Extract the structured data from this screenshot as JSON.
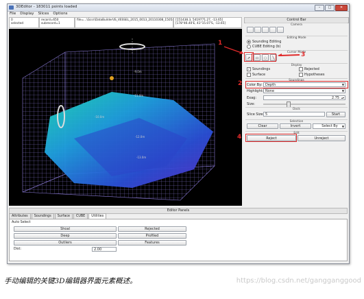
{
  "window": {
    "title": "3DEditor - 183011 points loaded",
    "controls": {
      "minimize": "–",
      "maximize": "□",
      "close": "✕"
    }
  },
  "menu": [
    "File",
    "Display",
    "Slices",
    "Options"
  ],
  "info": {
    "selection": "0\nselected",
    "record": "record=650\nsubrecord=1",
    "file": "file=...\\Gcsr\\DataBuilder\\IS_VESSEL_2015_0013_20110308_150546.gsd (0)",
    "coords": "[151438.3, 5419771.27, -13.65]\n[178°46.40'E, 41°15.07'S, -13.65]"
  },
  "view3d": {
    "labels": [
      "-9.0m",
      "-10.0m",
      "-11.0m",
      "-12.0m",
      "-13.0m",
      "-14.0m"
    ],
    "tick_top": "0.0m"
  },
  "control_bar": {
    "title": "Control Bar",
    "sections": {
      "camera": "Camera",
      "editing_mode": "Editing Mode",
      "cursor_mode": "Cursor Mode",
      "display": "Display",
      "soundings": "Soundings",
      "dock": "Dock",
      "selection": "Selection",
      "edit": "Edit"
    },
    "editing": {
      "sounding": "Sounding Editing",
      "cube": "CUBE Editing (b)"
    },
    "display": {
      "soundings": "Soundings",
      "rejected": "Rejected",
      "surface": "Surface",
      "hypotheses": "Hypotheses"
    },
    "color_by_label": "Color By:",
    "color_by_value": "Depth",
    "highlight_label": "Highlight:",
    "highlight_value": "None",
    "exag_label": "Exag:",
    "exag_value": "2.75",
    "size_label": "Size:",
    "slice_label": "Slice Size:",
    "slice_value": "5",
    "start": "Start",
    "clear": "Clear",
    "invert": "Invert",
    "select_by": "Select By",
    "reject": "Reject",
    "unreject": "Unreject"
  },
  "callouts": {
    "c1": "1",
    "c2": "2",
    "c3": "3",
    "c4": "4"
  },
  "editor_panels": {
    "title": "Editor Panels",
    "tabs": [
      "Attributes",
      "Soundings",
      "Surface",
      "CUBE",
      "Utilities"
    ],
    "auto_select": "Auto Select",
    "buttons": [
      "Shoal",
      "Rejected",
      "Deep",
      "Profiled",
      "Outliers",
      "Features"
    ],
    "dist_label": "Dist:",
    "dist_value": "2.00"
  },
  "caption": "手动编辑的关键3D编辑器界面元素概述。",
  "watermark": "https://blog.csdn.net/gangganggood",
  "colors": {
    "accent_red": "#e02a2a",
    "view_bg": "#000000",
    "grid": "#8b7bd8"
  }
}
